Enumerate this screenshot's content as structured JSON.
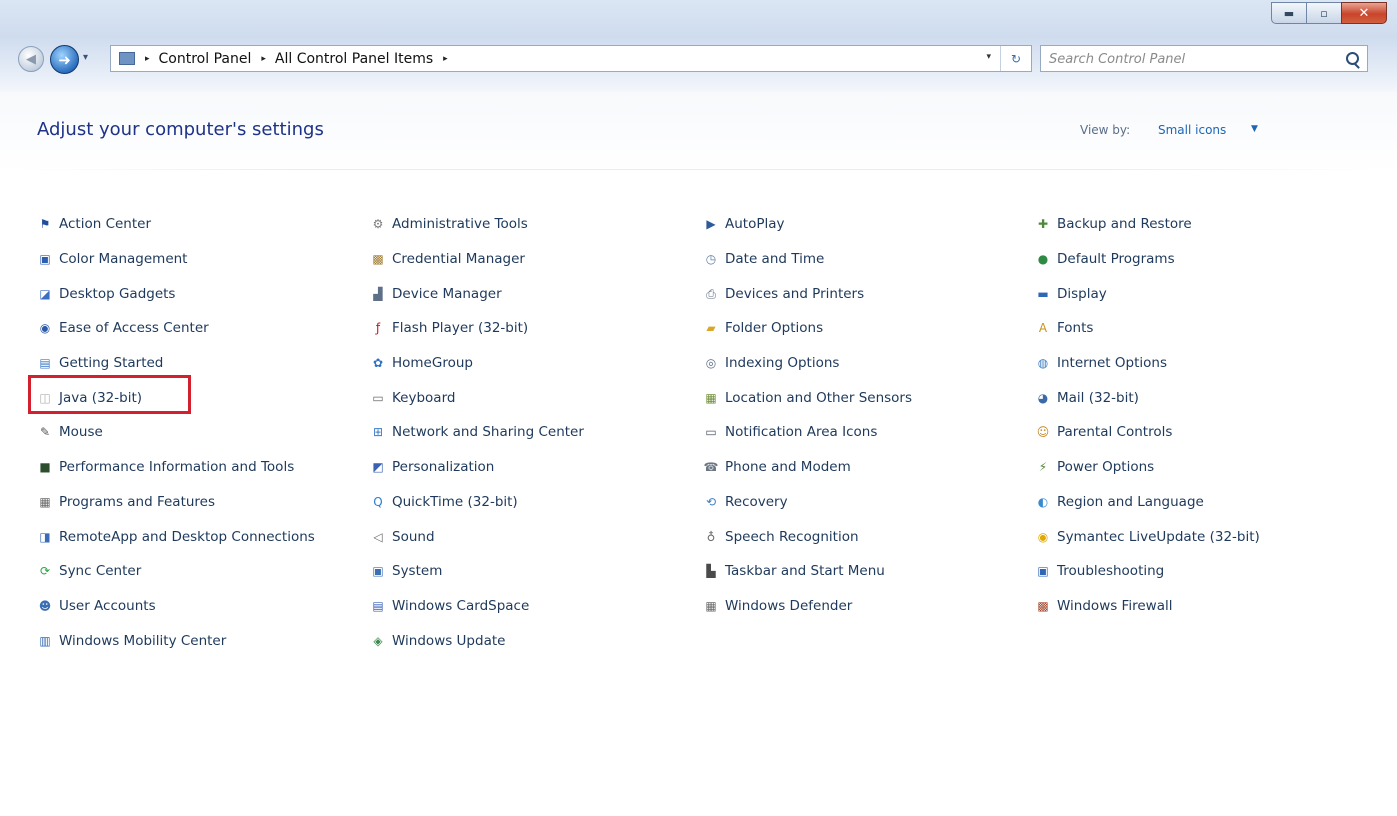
{
  "window": {
    "caption_buttons": {
      "minimize": "▬",
      "maximize": "▫",
      "close": "✕"
    }
  },
  "nav": {
    "recent_arrow": "▾",
    "breadcrumb": [
      "Control Panel",
      "All Control Panel Items"
    ],
    "breadcrumb_sep": "▸",
    "dropdown_arrow": "▾",
    "refresh_glyph": "↻",
    "search_placeholder": "Search Control Panel"
  },
  "header": {
    "title": "Adjust your computer's settings",
    "view_by_label": "View by:",
    "view_by_value": "Small icons",
    "view_by_arrow": "▼"
  },
  "columns": [
    [
      {
        "label": "Action Center",
        "icon": "flag-icon",
        "glyph": "⚑",
        "color": "#1f4e9a"
      },
      {
        "label": "Color Management",
        "icon": "monitor-icon",
        "glyph": "▣",
        "color": "#2d5fb0"
      },
      {
        "label": "Desktop Gadgets",
        "icon": "gadgets-icon",
        "glyph": "◪",
        "color": "#3a6fc4"
      },
      {
        "label": "Ease of Access Center",
        "icon": "accessibility-icon",
        "glyph": "◉",
        "color": "#2a5aa8"
      },
      {
        "label": "Getting Started",
        "icon": "document-icon",
        "glyph": "▤",
        "color": "#3d79c8"
      },
      {
        "label": "Java (32-bit)",
        "icon": "java-icon",
        "glyph": "◫",
        "color": "#b0b0b0"
      },
      {
        "label": "Mouse",
        "icon": "mouse-icon",
        "glyph": "✎",
        "color": "#555555"
      },
      {
        "label": "Performance Information and Tools",
        "icon": "performance-icon",
        "glyph": "■",
        "color": "#2e4c2e"
      },
      {
        "label": "Programs and Features",
        "icon": "programs-icon",
        "glyph": "▦",
        "color": "#6a6a6a"
      },
      {
        "label": "RemoteApp and Desktop Connections",
        "icon": "remote-desktop-icon",
        "glyph": "◨",
        "color": "#3b6cb8"
      },
      {
        "label": "Sync Center",
        "icon": "sync-icon",
        "glyph": "⟳",
        "color": "#2aa34a"
      },
      {
        "label": "User Accounts",
        "icon": "users-icon",
        "glyph": "☻",
        "color": "#3a6fb4"
      },
      {
        "label": "Windows Mobility Center",
        "icon": "mobility-icon",
        "glyph": "▥",
        "color": "#3269b1"
      }
    ],
    [
      {
        "label": "Administrative Tools",
        "icon": "admin-tools-icon",
        "glyph": "⚙",
        "color": "#7a7a7a"
      },
      {
        "label": "Credential Manager",
        "icon": "credential-icon",
        "glyph": "▩",
        "color": "#a07a2e"
      },
      {
        "label": "Device Manager",
        "icon": "device-manager-icon",
        "glyph": "▟",
        "color": "#5e6f88"
      },
      {
        "label": "Flash Player (32-bit)",
        "icon": "flash-icon",
        "glyph": "ƒ",
        "color": "#c4161c"
      },
      {
        "label": "HomeGroup",
        "icon": "homegroup-icon",
        "glyph": "✿",
        "color": "#2f6fc6"
      },
      {
        "label": "Keyboard",
        "icon": "keyboard-icon",
        "glyph": "▭",
        "color": "#6b6b6b"
      },
      {
        "label": "Network and Sharing Center",
        "icon": "network-icon",
        "glyph": "⊞",
        "color": "#3d7bc8"
      },
      {
        "label": "Personalization",
        "icon": "personalization-icon",
        "glyph": "◩",
        "color": "#3a62b0"
      },
      {
        "label": "QuickTime (32-bit)",
        "icon": "quicktime-icon",
        "glyph": "Q",
        "color": "#2c7fd6"
      },
      {
        "label": "Sound",
        "icon": "sound-icon",
        "glyph": "◁",
        "color": "#6b6b6b"
      },
      {
        "label": "System",
        "icon": "system-icon",
        "glyph": "▣",
        "color": "#3c6fb4"
      },
      {
        "label": "Windows CardSpace",
        "icon": "cardspace-icon",
        "glyph": "▤",
        "color": "#3a5fb8"
      },
      {
        "label": "Windows Update",
        "icon": "update-icon",
        "glyph": "◈",
        "color": "#3e8a4e"
      }
    ],
    [
      {
        "label": "AutoPlay",
        "icon": "autoplay-icon",
        "glyph": "▶",
        "color": "#2d5a9a"
      },
      {
        "label": "Date and Time",
        "icon": "clock-icon",
        "glyph": "◷",
        "color": "#5f7ea6"
      },
      {
        "label": "Devices and Printers",
        "icon": "printer-icon",
        "glyph": "⎙",
        "color": "#5b6b80"
      },
      {
        "label": "Folder Options",
        "icon": "folder-icon",
        "glyph": "▰",
        "color": "#d9a62b"
      },
      {
        "label": "Indexing Options",
        "icon": "indexing-icon",
        "glyph": "◎",
        "color": "#5d6f8a"
      },
      {
        "label": "Location and Other Sensors",
        "icon": "location-icon",
        "glyph": "▦",
        "color": "#6f8f3a"
      },
      {
        "label": "Notification Area Icons",
        "icon": "notification-icon",
        "glyph": "▭",
        "color": "#505a68"
      },
      {
        "label": "Phone and Modem",
        "icon": "phone-icon",
        "glyph": "☎",
        "color": "#6c7684"
      },
      {
        "label": "Recovery",
        "icon": "recovery-icon",
        "glyph": "⟲",
        "color": "#3f7ec4"
      },
      {
        "label": "Speech Recognition",
        "icon": "microphone-icon",
        "glyph": "♁",
        "color": "#6b6b6b"
      },
      {
        "label": "Taskbar and Start Menu",
        "icon": "taskbar-icon",
        "glyph": "▙",
        "color": "#4a4a4a"
      },
      {
        "label": "Windows Defender",
        "icon": "defender-icon",
        "glyph": "▦",
        "color": "#6b6b6b"
      }
    ],
    [
      {
        "label": "Backup and Restore",
        "icon": "backup-icon",
        "glyph": "✚",
        "color": "#4e8a3a"
      },
      {
        "label": "Default Programs",
        "icon": "default-programs-icon",
        "glyph": "●",
        "color": "#2f8a44"
      },
      {
        "label": "Display",
        "icon": "display-icon",
        "glyph": "▬",
        "color": "#2f66b8"
      },
      {
        "label": "Fonts",
        "icon": "fonts-icon",
        "glyph": "A",
        "color": "#c8931e"
      },
      {
        "label": "Internet Options",
        "icon": "internet-options-icon",
        "glyph": "◍",
        "color": "#3a7cc6"
      },
      {
        "label": "Mail (32-bit)",
        "icon": "mail-icon",
        "glyph": "◕",
        "color": "#3b6aaa"
      },
      {
        "label": "Parental Controls",
        "icon": "parental-controls-icon",
        "glyph": "☺",
        "color": "#c6831e"
      },
      {
        "label": "Power Options",
        "icon": "power-icon",
        "glyph": "⚡",
        "color": "#4f8a3a"
      },
      {
        "label": "Region and Language",
        "icon": "globe-icon",
        "glyph": "◐",
        "color": "#3a8ad0"
      },
      {
        "label": "Symantec LiveUpdate (32-bit)",
        "icon": "symantec-icon",
        "glyph": "◉",
        "color": "#e0a800"
      },
      {
        "label": "Troubleshooting",
        "icon": "troubleshooting-icon",
        "glyph": "▣",
        "color": "#2f66b8"
      },
      {
        "label": "Windows Firewall",
        "icon": "firewall-icon",
        "glyph": "▩",
        "color": "#a0462a"
      }
    ]
  ]
}
